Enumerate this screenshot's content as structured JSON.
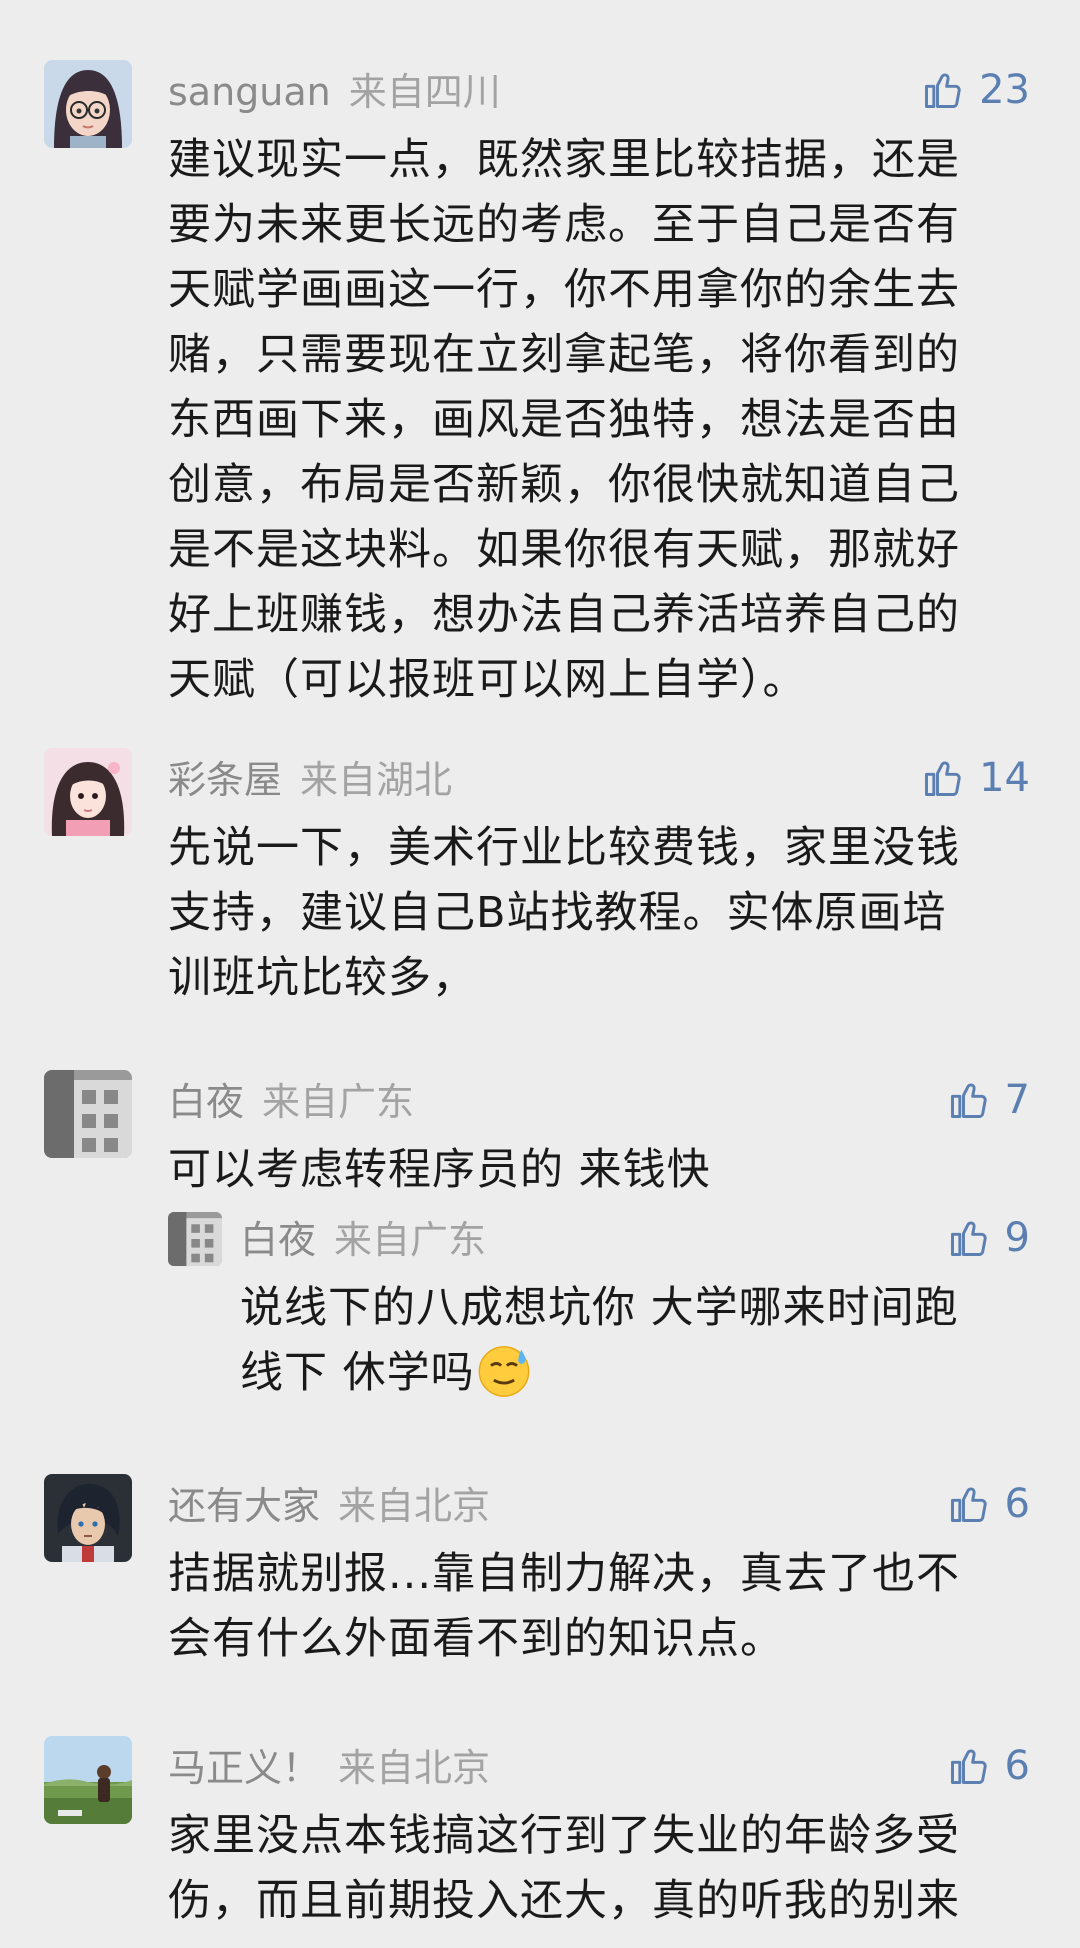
{
  "comments": [
    {
      "nick": "sanguan",
      "location": "来自四川",
      "likes": "23",
      "avatar": "woman-glasses-avatar",
      "text": "建议现实一点，既然家里比较拮据，还是\n要为未来更长远的考虑。至于自己是否有\n天赋学画画这一行，你不用拿你的余生去\n赌，只需要现在立刻拿起笔，将你看到的\n东西画下来，画风是否独特，想法是否由\n创意，布局是否新颖，你很快就知道自己\n是不是这块料。如果你很有天赋，那就好\n好上班赚钱，想办法自己养活培养自己的\n天赋（可以报班可以网上自学）。"
    },
    {
      "nick": "彩条屋",
      "location": "来自湖北",
      "likes": "14",
      "avatar": "anime-girl-avatar",
      "text": "先说一下，美术行业比较费钱，家里没钱\n支持，建议自己B站找教程。实体原画培\n训班坑比较多，"
    },
    {
      "nick": "白夜",
      "location": "来自广东",
      "likes": "7",
      "avatar": "building-photo-avatar",
      "text": "可以考虑转程序员的 来钱快",
      "reply": {
        "nick": "白夜",
        "location": "来自广东",
        "likes": "9",
        "avatar": "building-photo-avatar",
        "text": "说线下的八成想坑你 大学哪来时间跑\n线下 休学吗",
        "emoji": "sweat-smile-emoji"
      }
    },
    {
      "nick": "还有大家",
      "location": "来自北京",
      "likes": "6",
      "avatar": "anime-boy-avatar",
      "text": "拮据就别报...靠自制力解决，真去了也不\n会有什么外面看不到的知识点。"
    },
    {
      "nick": "马正义！",
      "location": "来自北京",
      "likes": "6",
      "avatar": "landscape-photo-avatar",
      "text": "家里没点本钱搞这行到了失业的年龄多受\n伤，而且前期投入还大，真的听我的别来"
    }
  ],
  "colors": {
    "background": "#ededed",
    "nick": "#8a8a8a",
    "location": "#a3a3a3",
    "like": "#5b7fb1",
    "text": "#1a1a1a"
  }
}
